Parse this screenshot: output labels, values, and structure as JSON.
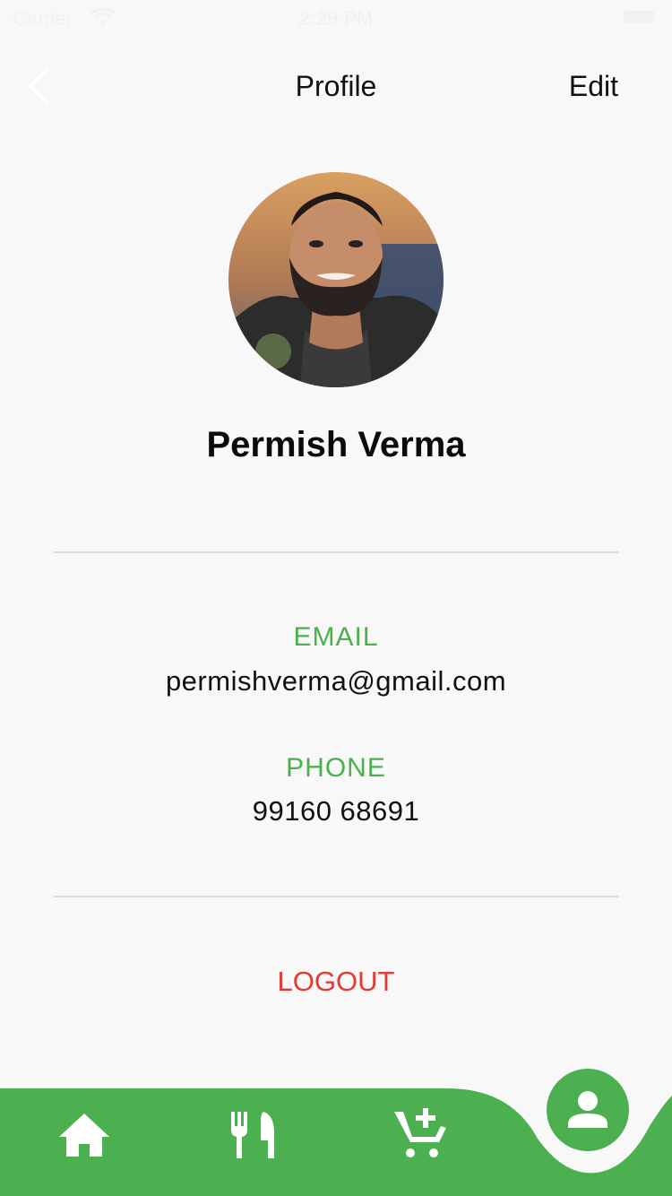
{
  "status_bar": {
    "carrier": "Carrier",
    "time": "2:29 PM"
  },
  "nav": {
    "title": "Profile",
    "edit_label": "Edit"
  },
  "profile": {
    "name": "Permish Verma",
    "email_label": "EMAIL",
    "email": "permishverma@gmail.com",
    "phone_label": "PHONE",
    "phone": "99160 68691"
  },
  "actions": {
    "logout_label": "LOGOUT"
  },
  "tab_bar": {
    "items": [
      {
        "icon": "home-icon"
      },
      {
        "icon": "restaurant-icon"
      },
      {
        "icon": "add-cart-icon"
      },
      {
        "icon": "person-icon",
        "active": true
      }
    ]
  },
  "colors": {
    "accent": "#4caf50",
    "danger": "#e53935",
    "background": "#f8f8f8"
  }
}
